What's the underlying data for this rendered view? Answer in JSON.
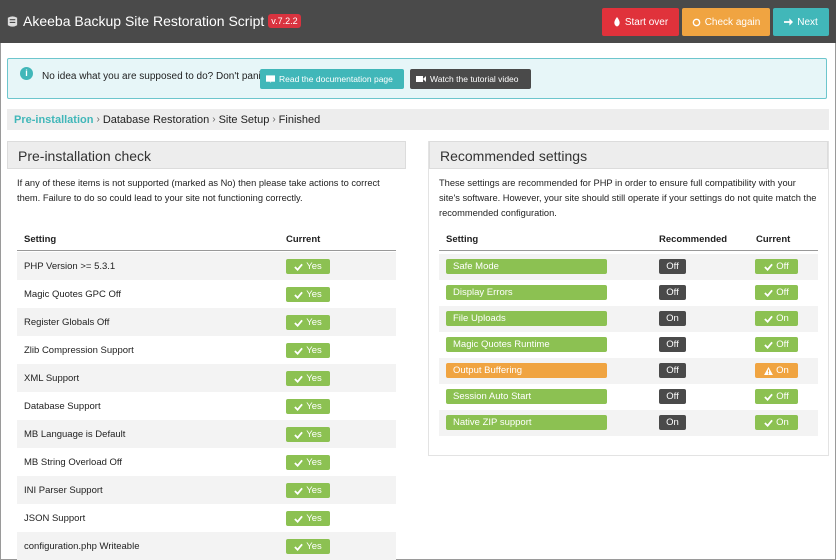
{
  "header": {
    "title": "Akeeba Backup Site Restoration Script",
    "version": "v.7.2.2",
    "buttons": {
      "start_over": "Start over",
      "check_again": "Check again",
      "next": "Next"
    }
  },
  "alert": {
    "text": "No idea what you are supposed to do? Don't panic!",
    "docs_button": "Read the documentation page",
    "video_button": "Watch the tutorial video"
  },
  "breadcrumb": [
    "Pre-installation",
    "Database Restoration",
    "Site Setup",
    "Finished"
  ],
  "preinstall": {
    "title": "Pre-installation check",
    "description": "If any of these items is not supported (marked as No) then please take actions to correct them. Failure to do so could lead to your site not functioning correctly.",
    "col_setting": "Setting",
    "col_current": "Current",
    "rows": [
      {
        "setting": "PHP Version >= 5.3.1",
        "current": "Yes"
      },
      {
        "setting": "Magic Quotes GPC Off",
        "current": "Yes"
      },
      {
        "setting": "Register Globals Off",
        "current": "Yes"
      },
      {
        "setting": "Zlib Compression Support",
        "current": "Yes"
      },
      {
        "setting": "XML Support",
        "current": "Yes"
      },
      {
        "setting": "Database Support",
        "current": "Yes"
      },
      {
        "setting": "MB Language is Default",
        "current": "Yes"
      },
      {
        "setting": "MB String Overload Off",
        "current": "Yes"
      },
      {
        "setting": "INI Parser Support",
        "current": "Yes"
      },
      {
        "setting": "JSON Support",
        "current": "Yes"
      },
      {
        "setting": "configuration.php Writeable",
        "current": "Yes"
      }
    ]
  },
  "recommended": {
    "title": "Recommended settings",
    "description": "These settings are recommended for PHP in order to ensure full compatibility with your site's software. However, your site should still operate if your settings do not quite match the recommended configuration.",
    "col_setting": "Setting",
    "col_recommended": "Recommended",
    "col_current": "Current",
    "rows": [
      {
        "setting": "Safe Mode",
        "recommended": "Off",
        "current": "Off",
        "status": "ok"
      },
      {
        "setting": "Display Errors",
        "recommended": "Off",
        "current": "Off",
        "status": "ok"
      },
      {
        "setting": "File Uploads",
        "recommended": "On",
        "current": "On",
        "status": "ok"
      },
      {
        "setting": "Magic Quotes Runtime",
        "recommended": "Off",
        "current": "Off",
        "status": "ok"
      },
      {
        "setting": "Output Buffering",
        "recommended": "Off",
        "current": "On",
        "status": "warning"
      },
      {
        "setting": "Session Auto Start",
        "recommended": "Off",
        "current": "Off",
        "status": "ok"
      },
      {
        "setting": "Native ZIP support",
        "recommended": "On",
        "current": "On",
        "status": "ok"
      }
    ]
  },
  "colors": {
    "ok": "#8cc152",
    "warning": "#f0a441",
    "accent": "#41b7b9",
    "danger": "#e0323b"
  }
}
